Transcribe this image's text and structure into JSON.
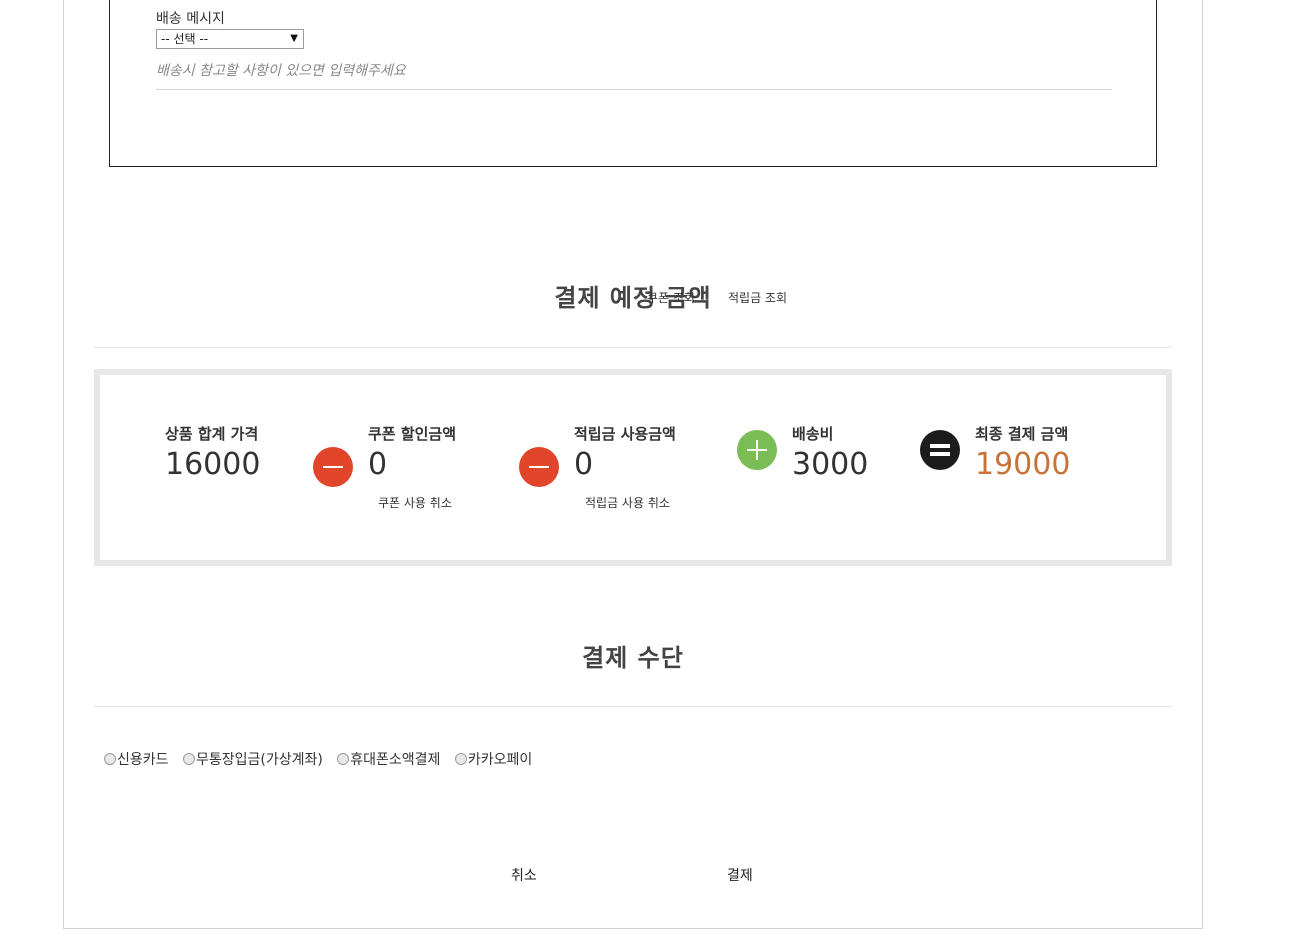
{
  "shipping": {
    "label": "배송 메시지",
    "select_value": "-- 선택 --",
    "hint": "배송시 참고할 사항이 있으면 입력해주세요"
  },
  "payment_amount": {
    "title": "결제 예정 금액",
    "coupon_lookup": "쿠폰 조회",
    "points_lookup": "적립금 조회",
    "product_total_label": "상품 합계 가격",
    "product_total_value": "16000",
    "coupon_discount_label": "쿠폰 할인금액",
    "coupon_discount_value": "0",
    "coupon_cancel": "쿠폰 사용 취소",
    "points_used_label": "적립금 사용금액",
    "points_used_value": "0",
    "points_cancel": "적립금 사용 취소",
    "shipping_fee_label": "배송비",
    "shipping_fee_value": "3000",
    "final_label": "최종 결제 금액",
    "final_value": "19000"
  },
  "payment_method": {
    "title": "결제 수단",
    "options": [
      "신용카드",
      "무통장입금(가상계좌)",
      "휴대폰소액결제",
      "카카오페이"
    ]
  },
  "actions": {
    "cancel": "취소",
    "pay": "결제"
  },
  "colors": {
    "minus": "#e2462a",
    "plus": "#7bbd55",
    "equals": "#1c1c1c",
    "final_amount": "#c8733a"
  },
  "icons": [
    "minus-circle-icon",
    "plus-circle-icon",
    "equals-circle-icon"
  ]
}
